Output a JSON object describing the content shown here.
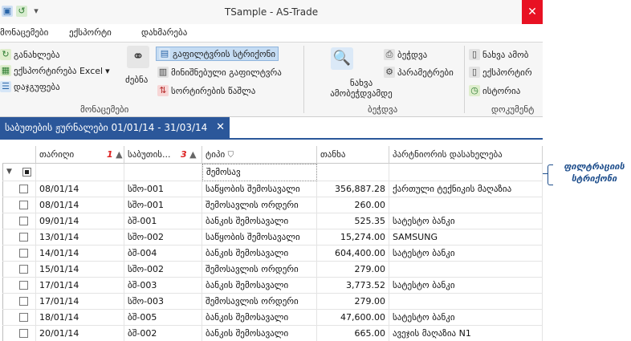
{
  "window": {
    "title": "TSample - AS-Trade",
    "close_symbol": "✕"
  },
  "menu": [
    "მონაცემები",
    "ექსპორტი",
    "დახმარება"
  ],
  "ribbon": {
    "data_group": {
      "label": "მონაცემები",
      "save": "განახლება",
      "export_excel": "ექსპორტირება Excel",
      "group": "დაჯგუფება",
      "search": "ძებნა",
      "filter_row": "გაფილტვრის სტრიქონი",
      "min_filter": "მინიშნებული გაფილტვრა",
      "clear_sort": "სორტირების წაშლა"
    },
    "print_group": {
      "label": "ბეჭდვა",
      "preview": "ნახვა ამობეჭდვამდე",
      "print": "ბეჭდვა",
      "params": "პარამეტრები"
    },
    "doc_group": {
      "label": "დოკუმენტ",
      "view": "ნახვა ამობ",
      "export": "ექსპორტირ",
      "history": "ისტორია"
    }
  },
  "doctab": {
    "title": "საბუთების ჟურნალები 01/01/14 - 31/03/14",
    "close": "✕"
  },
  "grid": {
    "columns": [
      "თარიღი",
      "საბუთის...",
      "ტიპი",
      "თანხა",
      "პარტნიორის დასახელება"
    ],
    "sort_indices": [
      "1",
      "3"
    ],
    "filter_value": "შემოსავ",
    "rows": [
      {
        "date": "08/01/14",
        "doc": "სშო-001",
        "type": "საწყობის შემოსავალი",
        "amount": "356,887.28",
        "partner": "ქართული ტექნიკის მაღაზია"
      },
      {
        "date": "08/01/14",
        "doc": "სშო-001",
        "type": "შემოსავლის ორდერი",
        "amount": "260.00",
        "partner": ""
      },
      {
        "date": "09/01/14",
        "doc": "ბშ-001",
        "type": "ბანკის შემოსავალი",
        "amount": "525.35",
        "partner": "სატესტო ბანკი"
      },
      {
        "date": "13/01/14",
        "doc": "სშო-002",
        "type": "საწყობის შემოსავალი",
        "amount": "15,274.00",
        "partner": "SAMSUNG"
      },
      {
        "date": "14/01/14",
        "doc": "ბშ-004",
        "type": "ბანკის შემოსავალი",
        "amount": "604,400.00",
        "partner": "სატესტო ბანკი"
      },
      {
        "date": "15/01/14",
        "doc": "სშო-002",
        "type": "შემოსავლის ორდერი",
        "amount": "279.00",
        "partner": ""
      },
      {
        "date": "17/01/14",
        "doc": "ბშ-003",
        "type": "ბანკის შემოსავალი",
        "amount": "3,773.52",
        "partner": "სატესტო ბანკი"
      },
      {
        "date": "17/01/14",
        "doc": "სშო-003",
        "type": "შემოსავლის ორდერი",
        "amount": "279.00",
        "partner": ""
      },
      {
        "date": "18/01/14",
        "doc": "ბშ-005",
        "type": "ბანკის შემოსავალი",
        "amount": "47,600.00",
        "partner": "სატესტო ბანკი"
      },
      {
        "date": "20/01/14",
        "doc": "ბშ-002",
        "type": "ბანკის შემოსავალი",
        "amount": "665.00",
        "partner": "ავეჯის მაღაზია N1"
      }
    ]
  },
  "callout": {
    "line1": "ფილტრაციის",
    "line2": "სტრიქონი"
  },
  "colors": {
    "accent": "#2b579a",
    "callout": "#1e4e8c",
    "close": "#e81123"
  },
  "icons": [
    "undo-icon",
    "save-icon",
    "binoculars-icon",
    "filter-row-icon",
    "preview-icon",
    "printer-icon",
    "history-icon"
  ]
}
